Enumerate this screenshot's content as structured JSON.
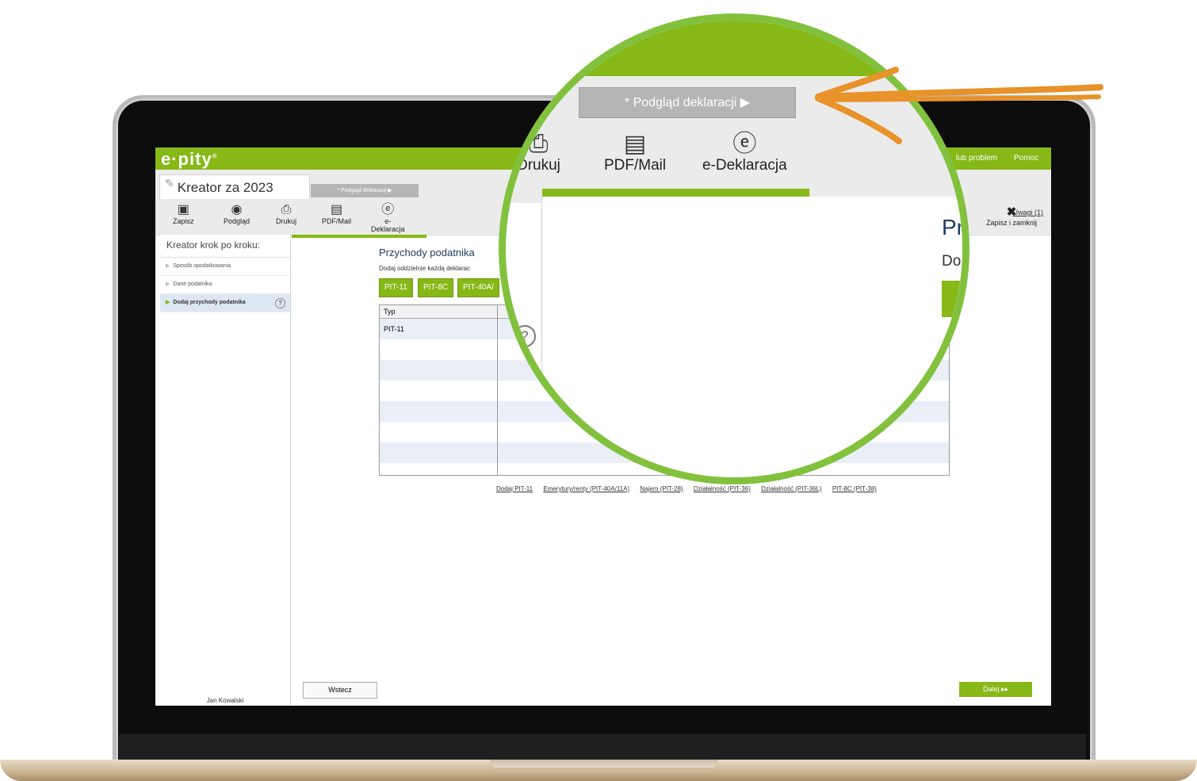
{
  "app": {
    "logo": "e·pity",
    "logo_sup": "®",
    "top_links": [
      "Zgłoś uwagę lub problem",
      "Pomoc"
    ],
    "top_links_visible": [
      "lub problem",
      "Pomoc"
    ]
  },
  "wizard": {
    "tab_title": "Kreator za 2023",
    "preview_tab": "* Podgląd deklaracji ▶",
    "toolbar": [
      "Zapisz",
      "Podgląd",
      "Drukuj",
      "PDF/Mail",
      "e-Deklaracja"
    ],
    "uwagi": "Uwagi (1)",
    "close_label": "Zapisz i zamknij"
  },
  "sidebar": {
    "header": "Kreator krok po kroku:",
    "items": [
      {
        "label": "Sposób opodatkowania"
      },
      {
        "label": "Dane podatnika"
      },
      {
        "label": "Dodaj przychody podatnika"
      }
    ],
    "user": "Jan Kowalski"
  },
  "main": {
    "title": "Przychody podatnika",
    "subtitle": "Dodaj oddzielnie każdą deklarac",
    "pit_buttons": [
      "PIT-11",
      "PIT-8C",
      "PIT-40A/"
    ],
    "table": {
      "headers": [
        "Typ",
        "N"
      ],
      "rows": [
        "PIT-11"
      ]
    },
    "bottom_links": [
      "Dodaj PIT-11",
      "Emerytury/renty (PIT-40A/11A)",
      "Najem (PIT-28)",
      "Działalność (PIT-36)",
      "Działalność (PIT-36L)",
      "PIT-8C (PIT-38)"
    ],
    "back_button": "Wstecz",
    "next_button": "Dalej ▸▸"
  },
  "magnifier": {
    "preview_tab": "* Podgląd deklaracji ▶",
    "tools": [
      "Drukuj",
      "PDF/Mail",
      "e-Deklaracja"
    ],
    "right_title": "Pr",
    "right_sub": "Do",
    "help_icon": "?"
  },
  "colors": {
    "brand_green": "#86b817",
    "magnifier_ring": "#82c13e",
    "arrow_orange": "#e8922a"
  }
}
